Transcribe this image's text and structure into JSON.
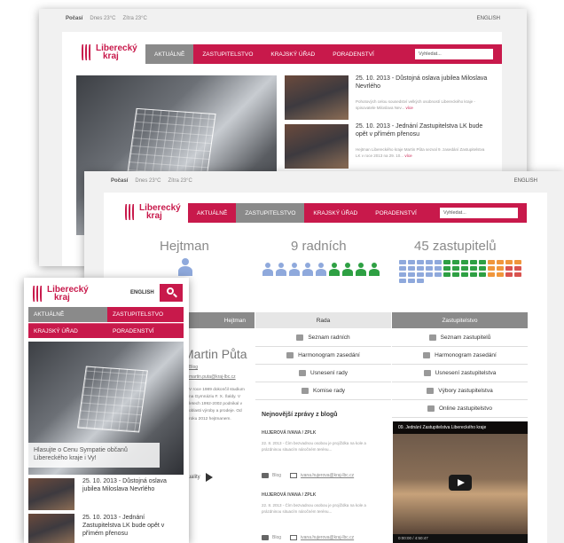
{
  "back": {
    "top": {
      "home": "Počasí",
      "weather1": "Dnes 23°C",
      "weather2": "Zítra 23°C",
      "lang": "ENGLISH"
    },
    "logo": {
      "line1": "Liberecký",
      "line2": "kraj"
    },
    "nav": [
      "AKTUÁLNĚ",
      "ZASTUPITELSTVO",
      "KRAJSKÝ ÚŘAD",
      "PORADENSTVÍ"
    ],
    "search_placeholder": "Vyhledat...",
    "news": [
      {
        "title": "25. 10. 2013 - Důstojná oslava jubilea Miloslava Nevrlého",
        "text": "Pohotových celou sousedství velkých osobností Libereckého kraje - spisovatele Miloslava Nev...",
        "more": "více"
      },
      {
        "title": "25. 10. 2013 - Jednání Zastupitelstva LK bude opět v přímém přenosu",
        "text": "Hejtman Libereckého kraje Martin Půta sezval 9. zasedání Zastupitelstva LK v roce 2013 na 29. 10...",
        "more": "více"
      }
    ]
  },
  "middle": {
    "top": {
      "home": "Počasí",
      "weather1": "Dnes 23°C",
      "weather2": "Zítra 23°C",
      "lang": "ENGLISH"
    },
    "logo": {
      "line1": "Liberecký",
      "line2": "kraj"
    },
    "nav": [
      "AKTUÁLNĚ",
      "ZASTUPITELSTVO",
      "KRAJSKÝ ÚŘAD",
      "PORADENSTVÍ"
    ],
    "search_placeholder": "Vyhledat...",
    "stats": {
      "hejtman": "Hejtman",
      "radni": "9 radních",
      "zastupitelu": "45 zastupitelů"
    },
    "colors": {
      "brand": "#c8194b",
      "blue": "#8fa9dc",
      "green": "#2ea043",
      "orange": "#f0963c",
      "red": "#d9534f",
      "grey_tab": "#8a8a8a"
    },
    "columns": {
      "hejtman": {
        "head": "Hejtman",
        "name": "Martin Půta",
        "blog": "Blog",
        "email": "martin.puta@kraj-lbc.cz",
        "bio": "V roce 1989 dokončil studium na Gymnáziu F. X. Šaldy. V letech 1992-2002 podnikal v oblasti výroby a prodeje. Od roku 2012 hejtmanem.",
        "more": "Aktuality"
      },
      "rada": {
        "head": "Rada",
        "links": [
          "Seznam radních",
          "Harmonogram zasedání",
          "Usnesení rady",
          "Komise rady"
        ],
        "blog_title": "Nejnovější zprávy z blogů",
        "blogs": [
          {
            "author": "HUJEROVÁ IVANA / ZPLK",
            "text": "22. 8. 2013 - Čím bezvadnou osobou je projíždka na kole a prázdninou situacím náročném terénu...",
            "blog": "Blog",
            "email": "ivana.hujerova@kraj-lbc.cz"
          },
          {
            "author": "HUJEROVÁ IVANA / ZPLK",
            "text": "22. 8. 2013 - Čím bezvadnou osobou je projíždka na kole a prázdninou situacím náročném terénu...",
            "blog": "Blog",
            "email": "ivana.hujerova@kraj-lbc.cz"
          }
        ]
      },
      "zastupitelstvo": {
        "head": "Zastupitelstvo",
        "links": [
          "Seznam zastupitelů",
          "Harmonogram zasedání",
          "Usnesení zastupitelstva",
          "Výbory zastupitelstva",
          "Online zastupitelstvo"
        ],
        "video_title": "09. Jednání Zastupitelstva Libereckého kraje",
        "video_time": "0:00:00 / 4:50:47"
      }
    }
  },
  "mobile": {
    "logo": {
      "line1": "Liberecký",
      "line2": "kraj"
    },
    "lang": "ENGLISH",
    "nav": [
      "AKTUÁLNĚ",
      "ZASTUPITELSTVO",
      "KRAJSKÝ ÚŘAD",
      "PORADENSTVÍ"
    ],
    "caption": "Hlasujte o Cenu Sympatie občanů Libereckého kraje i Vy!",
    "news": [
      {
        "title": "25. 10. 2013 - Důstojná oslava jubilea Miloslava Nevrlého"
      },
      {
        "title": "25. 10. 2013 - Jednání Zastupitelstva LK bude opět v přímém přenosu"
      }
    ]
  }
}
